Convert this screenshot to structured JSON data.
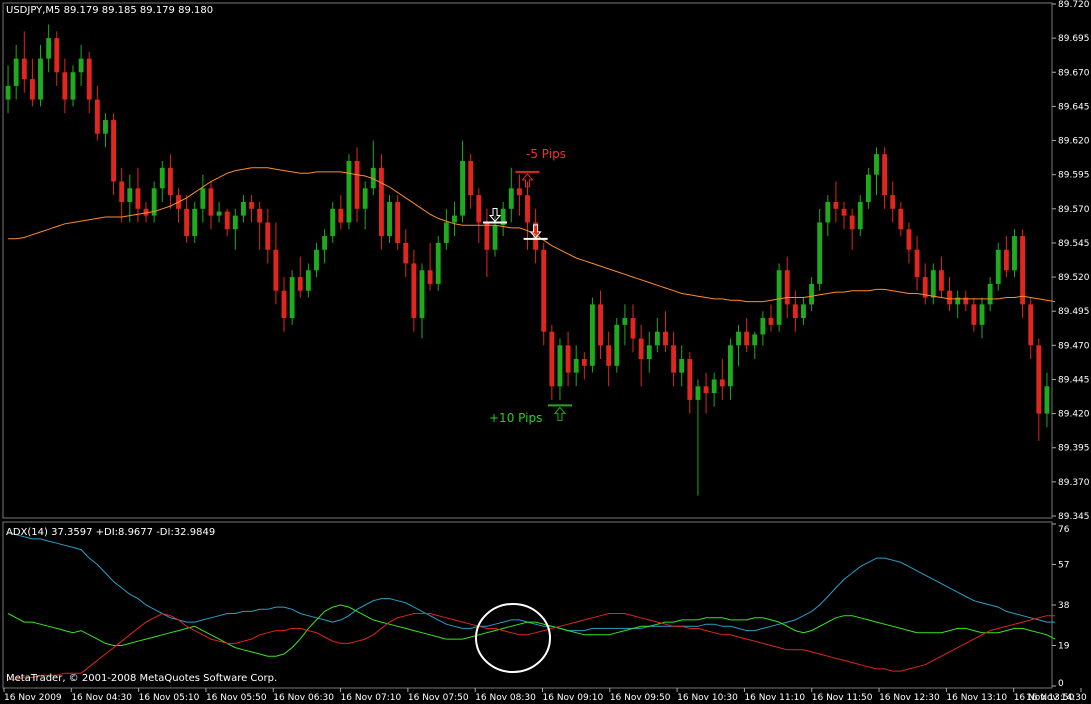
{
  "main": {
    "title": "USDJPY,M5  89.179 89.185 89.179 89.180",
    "price_labels": [
      "89.720",
      "89.695",
      "89.670",
      "89.645",
      "89.620",
      "89.595",
      "89.570",
      "89.545",
      "89.520",
      "89.495",
      "89.470",
      "89.445",
      "89.420",
      "89.395",
      "89.370",
      "89.345"
    ],
    "annotation_loss": "-5 Pips",
    "annotation_gain": "+10 Pips"
  },
  "adx": {
    "title": "ADX(14) 37.3597 +DI:8.9677 -DI:32.9849",
    "levels": [
      "76",
      "57",
      "38",
      "19",
      "0"
    ]
  },
  "footer": {
    "copyright": "MetaTrader, © 2001-2008 MetaQuotes Software Corp."
  },
  "time_labels": [
    "16 Nov 2009",
    "16 Nov 04:30",
    "16 Nov 05:10",
    "16 Nov 05:50",
    "16 Nov 06:30",
    "16 Nov 07:10",
    "16 Nov 07:50",
    "16 Nov 08:30",
    "16 Nov 09:10",
    "16 Nov 09:50",
    "16 Nov 10:30",
    "16 Nov 11:10",
    "16 Nov 11:50",
    "16 Nov 12:30",
    "16 Nov 13:10",
    "16 Nov 13:50",
    "16 Nov 14:30"
  ],
  "colors": {
    "background": "#000000",
    "bull": "#1faa1f",
    "bear": "#e0261f",
    "moving_average": "#ff8c2a",
    "adx_line": "#2a9fc8",
    "plus_di": "#39e61f",
    "minus_di": "#e0261f",
    "grid": "#777777"
  },
  "chart_data": {
    "type": "candlestick",
    "symbol": "USDJPY,M5",
    "ylim": [
      89.345,
      89.72
    ],
    "candles": [
      [
        89.65,
        89.675,
        89.64,
        89.66
      ],
      [
        89.66,
        89.69,
        89.65,
        89.68
      ],
      [
        89.68,
        89.7,
        89.655,
        89.665
      ],
      [
        89.665,
        89.68,
        89.645,
        89.65
      ],
      [
        89.65,
        89.69,
        89.645,
        89.68
      ],
      [
        89.68,
        89.705,
        89.67,
        89.695
      ],
      [
        89.695,
        89.7,
        89.66,
        89.67
      ],
      [
        89.67,
        89.68,
        89.64,
        89.65
      ],
      [
        89.65,
        89.675,
        89.645,
        89.67
      ],
      [
        89.67,
        89.69,
        89.66,
        89.68
      ],
      [
        89.68,
        89.685,
        89.64,
        89.65
      ],
      [
        89.65,
        89.66,
        89.62,
        89.625
      ],
      [
        89.625,
        89.64,
        89.615,
        89.635
      ],
      [
        89.635,
        89.64,
        89.58,
        89.59
      ],
      [
        89.59,
        89.6,
        89.56,
        89.575
      ],
      [
        89.575,
        89.595,
        89.56,
        89.585
      ],
      [
        89.585,
        89.6,
        89.56,
        89.57
      ],
      [
        89.57,
        89.575,
        89.56,
        89.565
      ],
      [
        89.565,
        89.59,
        89.56,
        89.585
      ],
      [
        89.585,
        89.605,
        89.575,
        89.6
      ],
      [
        89.6,
        89.61,
        89.57,
        89.58
      ],
      [
        89.58,
        89.585,
        89.56,
        89.57
      ],
      [
        89.57,
        89.58,
        89.545,
        89.55
      ],
      [
        89.55,
        89.575,
        89.545,
        89.57
      ],
      [
        89.57,
        89.595,
        89.56,
        89.585
      ],
      [
        89.585,
        89.59,
        89.555,
        89.565
      ],
      [
        89.565,
        89.575,
        89.56,
        89.568
      ],
      [
        89.568,
        89.57,
        89.55,
        89.555
      ],
      [
        89.555,
        89.57,
        89.54,
        89.565
      ],
      [
        89.565,
        89.58,
        89.56,
        89.575
      ],
      [
        89.575,
        89.58,
        89.56,
        89.57
      ],
      [
        89.57,
        89.575,
        89.54,
        89.56
      ],
      [
        89.56,
        89.57,
        89.53,
        89.54
      ],
      [
        89.54,
        89.56,
        89.5,
        89.51
      ],
      [
        89.51,
        89.52,
        89.48,
        89.49
      ],
      [
        89.49,
        89.525,
        89.485,
        89.52
      ],
      [
        89.52,
        89.535,
        89.505,
        89.51
      ],
      [
        89.51,
        89.53,
        89.505,
        89.525
      ],
      [
        89.525,
        89.545,
        89.52,
        89.54
      ],
      [
        89.54,
        89.555,
        89.53,
        89.55
      ],
      [
        89.55,
        89.575,
        89.545,
        89.57
      ],
      [
        89.57,
        89.58,
        89.555,
        89.56
      ],
      [
        89.56,
        89.61,
        89.555,
        89.605
      ],
      [
        89.605,
        89.615,
        89.56,
        89.57
      ],
      [
        89.57,
        89.59,
        89.555,
        89.585
      ],
      [
        89.585,
        89.62,
        89.58,
        89.6
      ],
      [
        89.6,
        89.61,
        89.54,
        89.55
      ],
      [
        89.55,
        89.58,
        89.545,
        89.575
      ],
      [
        89.575,
        89.58,
        89.54,
        89.545
      ],
      [
        89.545,
        89.555,
        89.52,
        89.53
      ],
      [
        89.53,
        89.54,
        89.48,
        89.49
      ],
      [
        89.49,
        89.53,
        89.475,
        89.525
      ],
      [
        89.525,
        89.545,
        89.51,
        89.515
      ],
      [
        89.515,
        89.55,
        89.51,
        89.545
      ],
      [
        89.545,
        89.57,
        89.54,
        89.56
      ],
      [
        89.56,
        89.575,
        89.55,
        89.565
      ],
      [
        89.565,
        89.62,
        89.56,
        89.605
      ],
      [
        89.605,
        89.61,
        89.57,
        89.58
      ],
      [
        89.58,
        89.585,
        89.545,
        89.56
      ],
      [
        89.56,
        89.57,
        89.52,
        89.54
      ],
      [
        89.54,
        89.565,
        89.535,
        89.558
      ],
      [
        89.558,
        89.575,
        89.55,
        89.57
      ],
      [
        89.57,
        89.6,
        89.56,
        89.585
      ],
      [
        89.585,
        89.595,
        89.565,
        89.58
      ],
      [
        89.58,
        89.59,
        89.54,
        89.56
      ],
      [
        89.56,
        89.57,
        89.53,
        89.54
      ],
      [
        89.54,
        89.545,
        89.47,
        89.48
      ],
      [
        89.48,
        89.485,
        89.43,
        89.44
      ],
      [
        89.44,
        89.475,
        89.43,
        89.47
      ],
      [
        89.47,
        89.48,
        89.44,
        89.45
      ],
      [
        89.45,
        89.47,
        89.44,
        89.46
      ],
      [
        89.46,
        89.465,
        89.445,
        89.455
      ],
      [
        89.455,
        89.505,
        89.45,
        89.5
      ],
      [
        89.5,
        89.51,
        89.46,
        89.47
      ],
      [
        89.47,
        89.48,
        89.44,
        89.455
      ],
      [
        89.455,
        89.49,
        89.45,
        89.485
      ],
      [
        89.485,
        89.5,
        89.47,
        89.49
      ],
      [
        89.49,
        89.5,
        89.465,
        89.475
      ],
      [
        89.475,
        89.485,
        89.44,
        89.46
      ],
      [
        89.46,
        89.48,
        89.45,
        89.47
      ],
      [
        89.47,
        89.49,
        89.465,
        89.48
      ],
      [
        89.48,
        89.495,
        89.465,
        89.47
      ],
      [
        89.47,
        89.48,
        89.44,
        89.45
      ],
      [
        89.45,
        89.47,
        89.44,
        89.46
      ],
      [
        89.46,
        89.465,
        89.42,
        89.43
      ],
      [
        89.43,
        89.445,
        89.36,
        89.44
      ],
      [
        89.44,
        89.45,
        89.42,
        89.435
      ],
      [
        89.435,
        89.45,
        89.425,
        89.445
      ],
      [
        89.445,
        89.46,
        89.43,
        89.44
      ],
      [
        89.44,
        89.475,
        89.43,
        89.47
      ],
      [
        89.47,
        89.485,
        89.455,
        89.48
      ],
      [
        89.48,
        89.49,
        89.465,
        89.47
      ],
      [
        89.47,
        89.48,
        89.46,
        89.478
      ],
      [
        89.478,
        89.495,
        89.47,
        89.49
      ],
      [
        89.49,
        89.5,
        89.48,
        89.485
      ],
      [
        89.485,
        89.53,
        89.48,
        89.525
      ],
      [
        89.525,
        89.535,
        89.49,
        89.5
      ],
      [
        89.5,
        89.51,
        89.48,
        89.49
      ],
      [
        89.49,
        89.505,
        89.485,
        89.5
      ],
      [
        89.5,
        89.52,
        89.495,
        89.515
      ],
      [
        89.515,
        89.57,
        89.51,
        89.56
      ],
      [
        89.56,
        89.58,
        89.55,
        89.575
      ],
      [
        89.575,
        89.59,
        89.56,
        89.57
      ],
      [
        89.57,
        89.575,
        89.555,
        89.565
      ],
      [
        89.565,
        89.57,
        89.54,
        89.555
      ],
      [
        89.555,
        89.58,
        89.55,
        89.575
      ],
      [
        89.575,
        89.6,
        89.57,
        89.595
      ],
      [
        89.595,
        89.615,
        89.58,
        89.61
      ],
      [
        89.61,
        89.615,
        89.57,
        89.58
      ],
      [
        89.58,
        89.59,
        89.56,
        89.57
      ],
      [
        89.57,
        89.575,
        89.55,
        89.555
      ],
      [
        89.555,
        89.56,
        89.53,
        89.54
      ],
      [
        89.54,
        89.55,
        89.51,
        89.52
      ],
      [
        89.52,
        89.53,
        89.5,
        89.505
      ],
      [
        89.505,
        89.53,
        89.5,
        89.525
      ],
      [
        89.525,
        89.535,
        89.505,
        89.51
      ],
      [
        89.51,
        89.52,
        89.495,
        89.5
      ],
      [
        89.5,
        89.51,
        89.49,
        89.505
      ],
      [
        89.505,
        89.51,
        89.495,
        89.5
      ],
      [
        89.5,
        89.505,
        89.48,
        89.485
      ],
      [
        89.485,
        89.505,
        89.475,
        89.5
      ],
      [
        89.5,
        89.52,
        89.495,
        89.515
      ],
      [
        89.515,
        89.545,
        89.51,
        89.54
      ],
      [
        89.54,
        89.55,
        89.52,
        89.525
      ],
      [
        89.525,
        89.555,
        89.52,
        89.55
      ],
      [
        89.55,
        89.555,
        89.49,
        89.5
      ],
      [
        89.5,
        89.505,
        89.46,
        89.47
      ],
      [
        89.47,
        89.475,
        89.4,
        89.42
      ],
      [
        89.42,
        89.45,
        89.41,
        89.44
      ]
    ],
    "moving_average": [
      89.548,
      89.548,
      89.549,
      89.551,
      89.553,
      89.555,
      89.557,
      89.559,
      89.56,
      89.561,
      89.562,
      89.563,
      89.564,
      89.564,
      89.564,
      89.565,
      89.566,
      89.567,
      89.568,
      89.57,
      89.572,
      89.575,
      89.578,
      89.582,
      89.586,
      89.59,
      89.593,
      89.596,
      89.598,
      89.599,
      89.6,
      89.6,
      89.6,
      89.599,
      89.598,
      89.597,
      89.596,
      89.596,
      89.597,
      89.597,
      89.597,
      89.597,
      89.596,
      89.595,
      89.594,
      89.592,
      89.589,
      89.586,
      89.582,
      89.578,
      89.574,
      89.57,
      89.566,
      89.563,
      89.561,
      89.559,
      89.558,
      89.558,
      89.558,
      89.558,
      89.558,
      89.557,
      89.556,
      89.556,
      89.554,
      89.551,
      89.547,
      89.543,
      89.54,
      89.537,
      89.534,
      89.532,
      89.53,
      89.528,
      89.526,
      89.524,
      89.522,
      89.52,
      89.518,
      89.516,
      89.514,
      89.512,
      89.51,
      89.508,
      89.507,
      89.506,
      89.505,
      89.504,
      89.504,
      89.503,
      89.503,
      89.502,
      89.502,
      89.502,
      89.503,
      89.504,
      89.505,
      89.505,
      89.505,
      89.506,
      89.507,
      89.508,
      89.509,
      89.509,
      89.51,
      89.51,
      89.51,
      89.511,
      89.511,
      89.51,
      89.509,
      89.508,
      89.508,
      89.507,
      89.506,
      89.505,
      89.504,
      89.504,
      89.504,
      89.504,
      89.504,
      89.504,
      89.504,
      89.505,
      89.505,
      89.506,
      89.505,
      89.504,
      89.503,
      89.502
    ],
    "adx_series": {
      "adx": [
        72,
        71,
        70,
        69,
        69,
        68,
        67,
        66,
        65,
        64,
        60,
        57,
        53,
        49,
        46,
        43,
        41,
        38,
        36,
        34,
        32,
        31,
        30,
        30,
        31,
        32,
        33,
        34,
        34,
        35,
        35,
        36,
        36,
        37,
        37,
        36,
        34,
        33,
        32,
        31,
        30,
        31,
        33,
        36,
        38,
        40,
        41,
        41,
        40,
        39,
        37,
        35,
        33,
        31,
        29,
        28,
        27,
        27,
        28,
        28,
        29,
        30,
        31,
        31,
        30,
        29,
        28,
        28,
        27,
        26,
        26,
        26,
        27,
        27,
        27,
        27,
        27,
        27,
        27,
        28,
        28,
        28,
        28,
        28,
        28,
        28,
        29,
        29,
        28,
        28,
        27,
        26,
        26,
        27,
        28,
        29,
        30,
        31,
        33,
        35,
        38,
        42,
        46,
        50,
        53,
        56,
        58,
        60,
        60,
        59,
        58,
        56,
        54,
        52,
        50,
        48,
        46,
        44,
        42,
        40,
        39,
        38,
        37,
        35,
        34,
        33,
        32,
        31,
        30,
        30
      ],
      "plus_di": [
        34,
        32,
        30,
        30,
        29,
        28,
        27,
        26,
        25,
        26,
        24,
        22,
        20,
        19,
        19,
        20,
        21,
        22,
        23,
        24,
        25,
        26,
        27,
        28,
        26,
        24,
        22,
        20,
        18,
        17,
        16,
        15,
        14,
        14,
        15,
        18,
        22,
        27,
        31,
        35,
        37,
        38,
        37,
        35,
        33,
        31,
        30,
        29,
        28,
        27,
        26,
        25,
        24,
        23,
        22,
        22,
        22,
        23,
        24,
        25,
        26,
        27,
        28,
        29,
        30,
        30,
        29,
        28,
        27,
        26,
        25,
        24,
        24,
        24,
        24,
        25,
        26,
        27,
        28,
        28,
        29,
        30,
        30,
        31,
        31,
        31,
        32,
        32,
        32,
        31,
        31,
        31,
        32,
        32,
        31,
        30,
        28,
        26,
        25,
        26,
        28,
        30,
        32,
        33,
        33,
        32,
        31,
        30,
        29,
        28,
        27,
        26,
        25,
        25,
        25,
        25,
        26,
        27,
        27,
        26,
        25,
        25,
        25,
        26,
        27,
        27,
        26,
        25,
        24,
        22
      ],
      "minus_di": [
        3,
        3,
        4,
        4,
        5,
        5,
        5,
        6,
        6,
        6,
        9,
        12,
        15,
        18,
        21,
        24,
        27,
        30,
        32,
        34,
        33,
        31,
        28,
        26,
        24,
        22,
        21,
        20,
        20,
        21,
        22,
        24,
        25,
        26,
        26,
        27,
        27,
        26,
        25,
        23,
        21,
        20,
        20,
        21,
        22,
        24,
        27,
        30,
        32,
        33,
        34,
        34,
        34,
        33,
        32,
        31,
        30,
        29,
        28,
        27,
        27,
        26,
        25,
        24,
        24,
        25,
        26,
        27,
        28,
        29,
        30,
        31,
        32,
        33,
        34,
        34,
        34,
        33,
        32,
        31,
        30,
        29,
        28,
        28,
        27,
        27,
        26,
        25,
        24,
        24,
        23,
        22,
        21,
        20,
        19,
        18,
        17,
        17,
        17,
        16,
        15,
        14,
        13,
        12,
        11,
        10,
        9,
        8,
        8,
        7,
        7,
        8,
        9,
        10,
        12,
        14,
        16,
        18,
        20,
        22,
        24,
        26,
        27,
        28,
        29,
        30,
        31,
        32,
        33,
        33
      ]
    },
    "adx_ylim": [
      0,
      76
    ],
    "signals": [
      {
        "type": "sell-arrow",
        "candle": 60,
        "price": 89.56
      },
      {
        "type": "sell-arrow",
        "candle": 65,
        "price": 89.548
      },
      {
        "type": "stop-arrow",
        "candle": 64,
        "price": 89.597
      },
      {
        "type": "target-arrow",
        "candle": 68,
        "price": 89.426
      }
    ]
  }
}
